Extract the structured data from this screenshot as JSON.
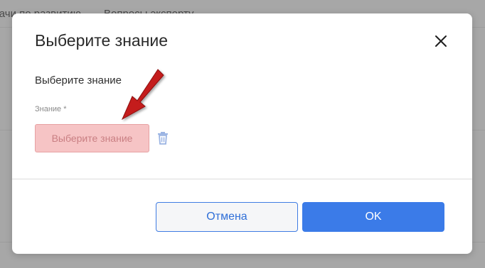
{
  "background": {
    "tabs": [
      "дачи по развитию",
      "Вопросы эксперту"
    ]
  },
  "modal": {
    "title": "Выберите знание",
    "close_icon": "close-icon",
    "section_label": "Выберите знание",
    "field_label": "Знание *",
    "select_button_label": "Выберите знание",
    "trash_icon": "trash-icon",
    "cancel_label": "Отмена",
    "ok_label": "OK"
  },
  "annotation": {
    "icon": "red-arrow-icon",
    "color": "#c41c1c"
  },
  "colors": {
    "primary": "#3b7be8",
    "error_fill": "#f6c4c5",
    "error_border": "#e7a1a3",
    "error_text": "#c97f83"
  }
}
